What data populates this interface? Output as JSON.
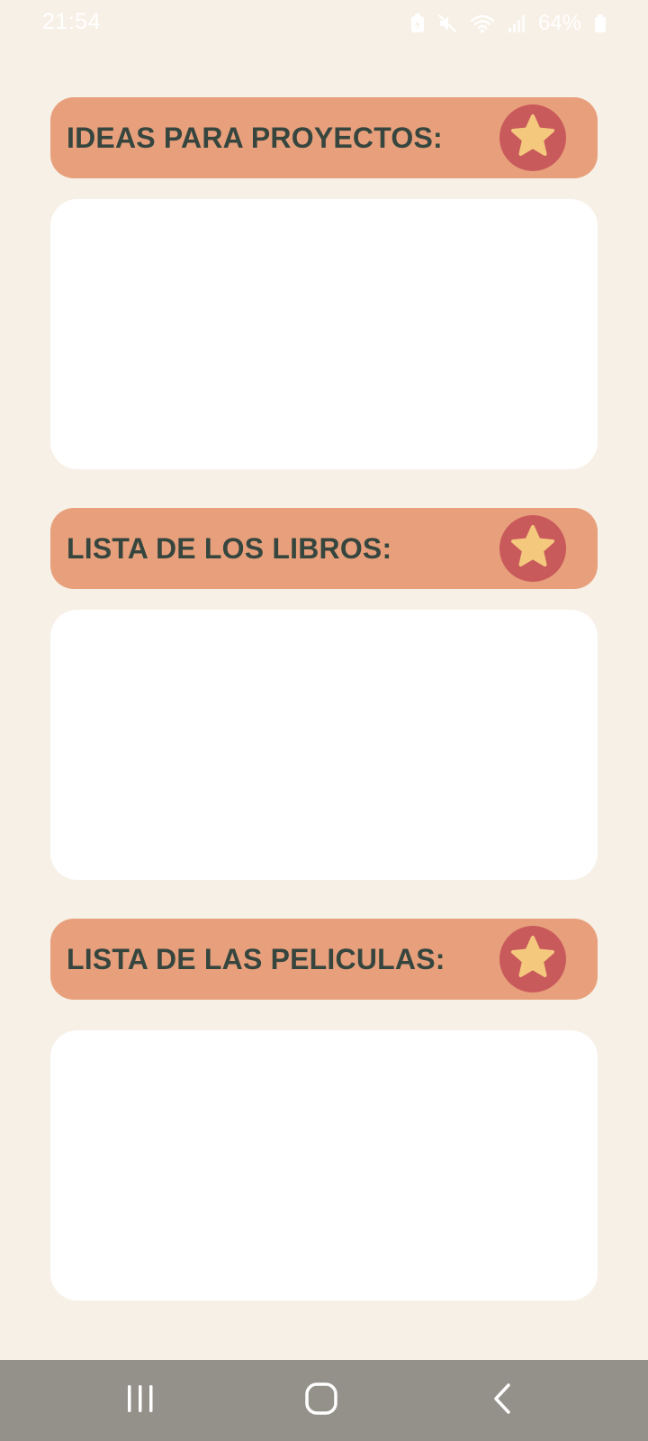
{
  "status_bar": {
    "time": "21:54",
    "battery": "64%",
    "icons": [
      "battery-saver-icon",
      "mute-icon",
      "wifi-icon",
      "signal-icon",
      "battery-icon"
    ]
  },
  "cards": [
    {
      "title": "IDEAS PARA PROYECTOS:",
      "icon": "star-icon",
      "content": ""
    },
    {
      "title": "LISTA DE LOS LIBROS:",
      "icon": "star-icon",
      "content": ""
    },
    {
      "title": "LISTA DE LAS PELICULAS:",
      "icon": "star-icon",
      "content": ""
    }
  ],
  "nav_bar": {
    "buttons": [
      "recent-apps-icon",
      "home-icon",
      "back-icon"
    ]
  },
  "colors": {
    "background": "#f7f0e6",
    "header": "#e8a07c",
    "title_text": "#36463f",
    "star_circle": "#c95a5c",
    "star": "#f4c97e",
    "card_body": "#ffffff",
    "nav_bar": "#94908a"
  }
}
